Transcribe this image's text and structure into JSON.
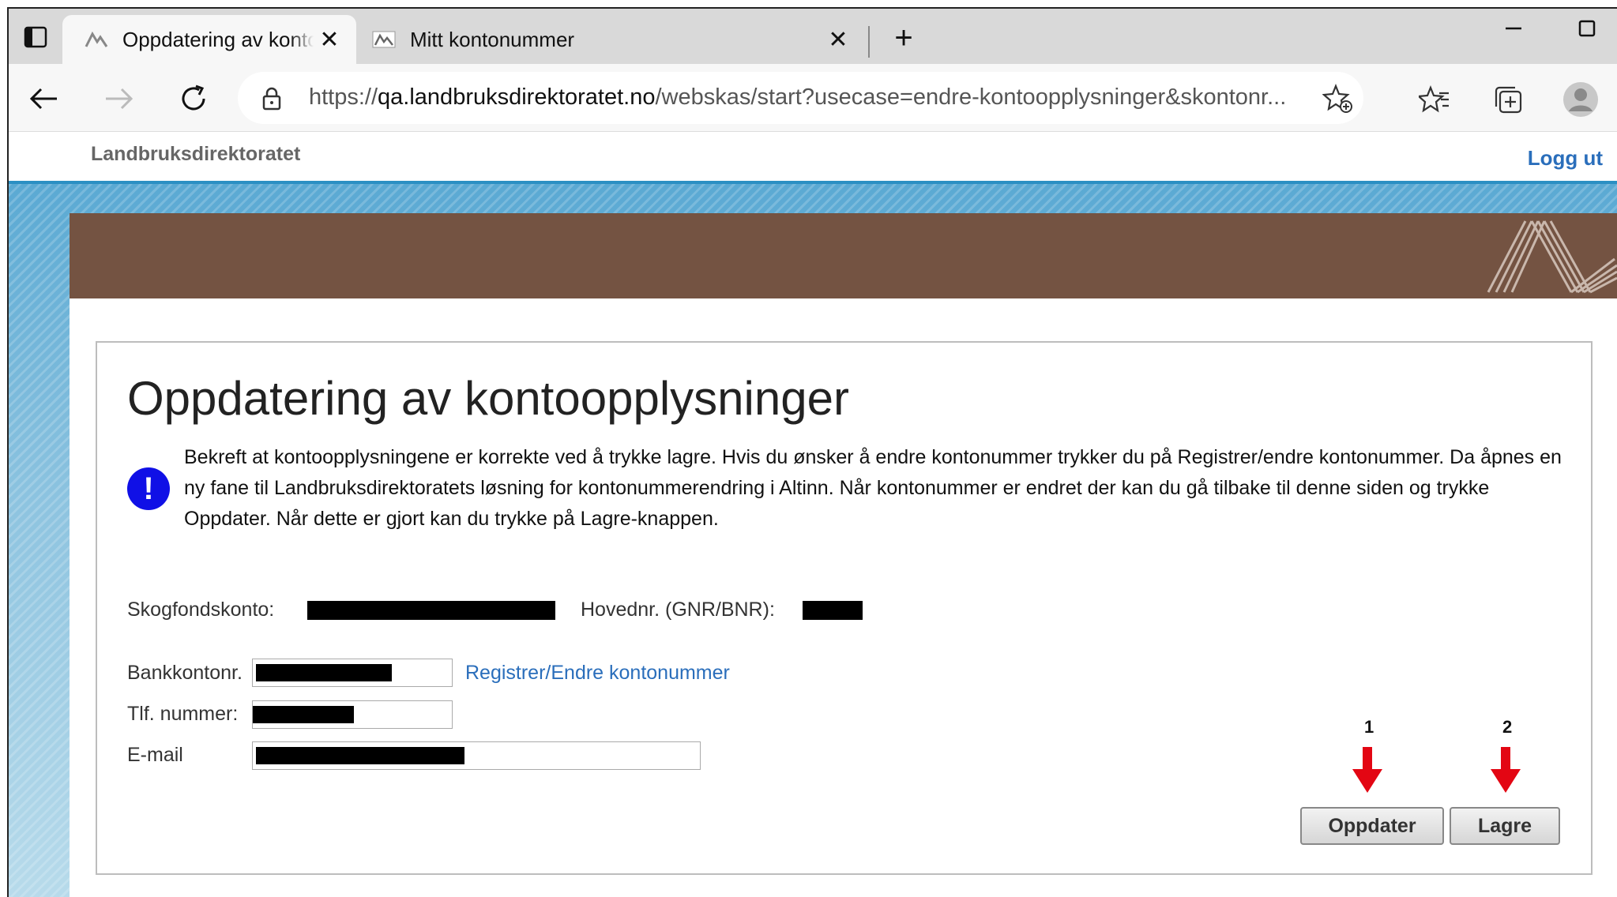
{
  "browser": {
    "tabs": [
      {
        "title": "Oppdatering av kontoopplysninger",
        "close": "✕"
      },
      {
        "title": "Mitt kontonummer",
        "close": "✕"
      }
    ],
    "new_tab": "+",
    "url_prefix": "https://",
    "url_host": "qa.landbruksdirektoratet.no",
    "url_path": "/webskas/start?usecase=endre-kontoopplysninger&skontonr..."
  },
  "header": {
    "brand": "Landbruksdirektoratet",
    "logout": "Logg ut"
  },
  "page": {
    "title": "Oppdatering av kontoopplysninger",
    "info_icon": "!",
    "info_text": "Bekreft at kontoopplysningene er korrekte ved å trykke lagre. Hvis du ønsker å endre kontonummer trykker du på Registrer/endre kontonummer. Da åpnes en ny fane til Landbruksdirektoratets løsning for kontonummerendring i Altinn. Når kontonummer er endret der kan du gå tilbake til denne siden og trykke Oppdater. Når dette er gjort kan du trykke på Lagre-knappen."
  },
  "form": {
    "skogfondskonto_label": "Skogfondskonto:",
    "hovednr_label": "Hovednr. (GNR/BNR):",
    "bankkontonr_label": "Bankkontonr.",
    "register_link": "Registrer/Endre kontonummer",
    "tlf_label": "Tlf. nummer:",
    "email_label": "E-mail"
  },
  "annotations": {
    "step1": "1",
    "step2": "2",
    "arrow_color": "#e30613"
  },
  "buttons": {
    "oppdater": "Oppdater",
    "lagre": "Lagre"
  },
  "colors": {
    "banner": "#745342",
    "accent_blue": "#2b8fc3",
    "link": "#2a6ebb",
    "info_icon": "#1010e6"
  }
}
